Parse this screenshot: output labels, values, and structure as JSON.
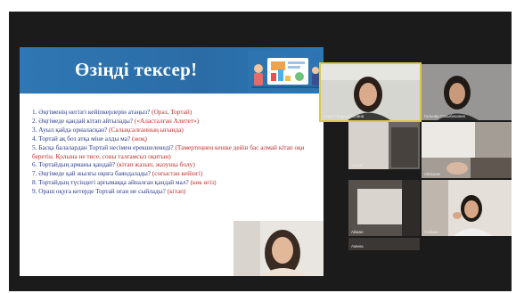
{
  "top_text": "",
  "slide": {
    "title": "Өзіңді тексер!",
    "questions": [
      {
        "q": "1. Әңгіменің  негізгі кейіпкерлерін атаңыз?",
        "a": "(Ораз, Тортай)"
      },
      {
        "q": "2. Әңгімеде қандай кітап айтылады?",
        "a": "(«Аласталған Алитет»)"
      },
      {
        "q": "3. Ауыл қайда орналасқан?",
        "a": "(Салықсалғанның ығында)"
      },
      {
        "q": "4. Тортай ақ боз атқа міне алды ма?",
        "a": "(жоқ)"
      },
      {
        "q": "5. Басқа балалардан Тортай несімен ерекшеленеді?",
        "a": "(Тамертеңнен кешке дейін бас алмай кітап оқи беретін. Қолына не тисе, соны талғамсыз оқитын)"
      },
      {
        "q": "6. Тортайдың арманы қандай?",
        "a": "(кітап жазып, жазушы болу)"
      },
      {
        "q": "7. Әңгімеде қай жылғы оқиға баяндалады?",
        "a": "(соғыстан кейінгі)"
      },
      {
        "q": "8. Тортайдың түсіндегі арғымаққа айналған қандай мал?",
        "a": "(көк өгіз)"
      },
      {
        "q": "9. Ораш оқуға кетерде Тортай оған не сыйлады?",
        "a": "(кітап)"
      }
    ]
  },
  "participants": [
    {
      "name": "Сарал Кадырбековна"
    },
    {
      "name": "Гульнар Сакыбековна"
    },
    {
      "name": "Артем"
    },
    {
      "name": "Айгерим"
    },
    {
      "name": "Айжан"
    },
    {
      "name": "Сабина"
    },
    {
      "name": "Амина"
    }
  ],
  "colors": {
    "meeting_bg": "#1b1b1b",
    "slide_header": "#2b6ca5",
    "question_text": "#2a3a8c",
    "answer_text": "#c22c2c",
    "active_speaker": "#d8c84a"
  }
}
